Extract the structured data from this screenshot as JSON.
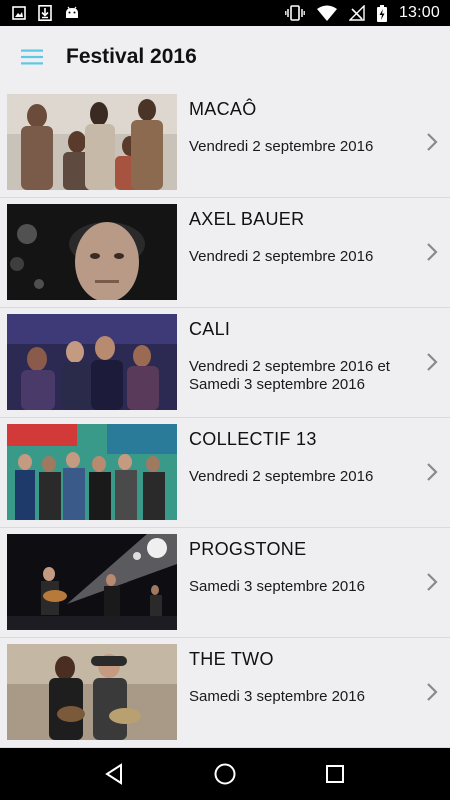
{
  "status_bar": {
    "time": "13:00",
    "left_icons": [
      "image-icon",
      "download-icon",
      "android-icon"
    ],
    "right_icons": [
      "vibrate-icon",
      "wifi-icon",
      "no-signal-icon",
      "battery-charging-icon"
    ]
  },
  "app_bar": {
    "title": "Festival 2016",
    "menu_icon": "hamburger-menu-icon",
    "accent_color": "#5bc8e6"
  },
  "artists": [
    {
      "name": "MACAÔ",
      "date": "Vendredi 2 septembre 2016",
      "thumbnail": "band-photo"
    },
    {
      "name": "AXEL BAUER",
      "date": "Vendredi 2 septembre 2016",
      "thumbnail": "portrait-photo"
    },
    {
      "name": "CALI",
      "date": "Vendredi 2 septembre 2016 et Samedi 3 septembre 2016",
      "thumbnail": "crowd-photo"
    },
    {
      "name": "COLLECTIF 13",
      "date": "Vendredi 2 septembre 2016",
      "thumbnail": "group-photo"
    },
    {
      "name": "PROGSTONE",
      "date": "Samedi 3 septembre 2016",
      "thumbnail": "concert-stage-photo"
    },
    {
      "name": "THE TWO",
      "date": "Samedi 3 septembre 2016",
      "thumbnail": "duo-guitar-photo"
    }
  ],
  "nav_bar": {
    "icons": [
      "back-icon",
      "home-icon",
      "recents-icon"
    ]
  }
}
